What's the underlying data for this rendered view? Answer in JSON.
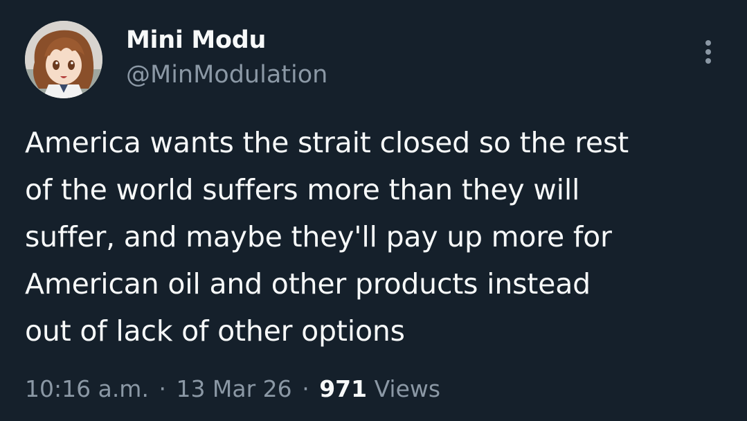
{
  "author": {
    "display_name": "Mini Modu",
    "handle": "@MinModulation",
    "avatar_icon": "anime-girl-avatar"
  },
  "tweet": {
    "lines": [
      "America wants the strait closed so the rest",
      "of the world suffers more than they will",
      "suffer, and maybe they'll pay up more for",
      "American oil and other products instead",
      "out of lack of other options"
    ]
  },
  "meta": {
    "time": "10:16 a.m.",
    "separator": "·",
    "date": "13 Mar 26",
    "views_count": "971",
    "views_label": "Views"
  },
  "menu": {
    "icon": "more-vertical-icon"
  },
  "colors": {
    "background": "#15202b",
    "primary_text": "#f7f9f9",
    "secondary_text": "#8b98a5"
  }
}
